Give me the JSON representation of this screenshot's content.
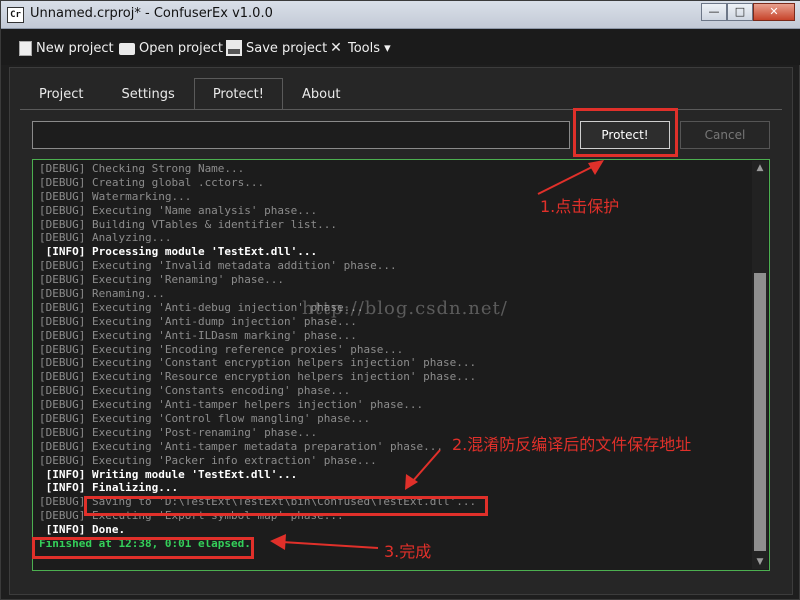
{
  "window": {
    "app_icon_text": "Cr",
    "title": "Unnamed.crproj* - ConfuserEx v1.0.0",
    "minimize": "—",
    "maximize": "□",
    "close": "✕"
  },
  "menu": {
    "new_project": "New project",
    "open_project": "Open project",
    "save_project": "Save project",
    "tools": "Tools ▾"
  },
  "tabs": [
    "Project",
    "Settings",
    "Protect!",
    "About"
  ],
  "protect": {
    "path_value": "",
    "protect_label": "Protect!",
    "cancel_label": "Cancel"
  },
  "log": [
    {
      "text": "[DEBUG] Checking Strong Name...",
      "level": "debug"
    },
    {
      "text": "[DEBUG] Creating global .cctors...",
      "level": "debug"
    },
    {
      "text": "[DEBUG] Watermarking...",
      "level": "debug"
    },
    {
      "text": "[DEBUG] Executing 'Name analysis' phase...",
      "level": "debug"
    },
    {
      "text": "[DEBUG] Building VTables & identifier list...",
      "level": "debug"
    },
    {
      "text": "[DEBUG] Analyzing...",
      "level": "debug"
    },
    {
      "text": " [INFO] Processing module 'TestExt.dll'...",
      "level": "info"
    },
    {
      "text": "[DEBUG] Executing 'Invalid metadata addition' phase...",
      "level": "debug"
    },
    {
      "text": "[DEBUG] Executing 'Renaming' phase...",
      "level": "debug"
    },
    {
      "text": "[DEBUG] Renaming...",
      "level": "debug"
    },
    {
      "text": "[DEBUG] Executing 'Anti-debug injection' phase...",
      "level": "debug"
    },
    {
      "text": "[DEBUG] Executing 'Anti-dump injection' phase...",
      "level": "debug"
    },
    {
      "text": "[DEBUG] Executing 'Anti-ILDasm marking' phase...",
      "level": "debug"
    },
    {
      "text": "[DEBUG] Executing 'Encoding reference proxies' phase...",
      "level": "debug"
    },
    {
      "text": "[DEBUG] Executing 'Constant encryption helpers injection' phase...",
      "level": "debug"
    },
    {
      "text": "[DEBUG] Executing 'Resource encryption helpers injection' phase...",
      "level": "debug"
    },
    {
      "text": "[DEBUG] Executing 'Constants encoding' phase...",
      "level": "debug"
    },
    {
      "text": "[DEBUG] Executing 'Anti-tamper helpers injection' phase...",
      "level": "debug"
    },
    {
      "text": "[DEBUG] Executing 'Control flow mangling' phase...",
      "level": "debug"
    },
    {
      "text": "[DEBUG] Executing 'Post-renaming' phase...",
      "level": "debug"
    },
    {
      "text": "[DEBUG] Executing 'Anti-tamper metadata preparation' phase...",
      "level": "debug"
    },
    {
      "text": "[DEBUG] Executing 'Packer info extraction' phase...",
      "level": "debug"
    },
    {
      "text": " [INFO] Writing module 'TestExt.dll'...",
      "level": "info"
    },
    {
      "text": " [INFO] Finalizing...",
      "level": "info"
    },
    {
      "text": "[DEBUG] Saving to 'D:\\TestExt\\TestExt\\bin\\Confused\\TestExt.dll'...",
      "level": "debug"
    },
    {
      "text": "[DEBUG] Executing 'Export symbol map' phase...",
      "level": "debug"
    },
    {
      "text": " [INFO] Done.",
      "level": "info"
    },
    {
      "text": "Finished at 12:38, 0:01 elapsed.",
      "level": "done"
    }
  ],
  "scroll": {
    "up": "▲",
    "down": "▼"
  },
  "annotations": {
    "click_protect": "1.点击保护",
    "output_path": "2.混淆防反编译后的文件保存地址",
    "finished": "3.完成",
    "color": "#e0302a"
  },
  "watermark": "http://blog.csdn.net/",
  "colors": {
    "log_border": "#4caf50",
    "done_text": "#34d05a"
  }
}
